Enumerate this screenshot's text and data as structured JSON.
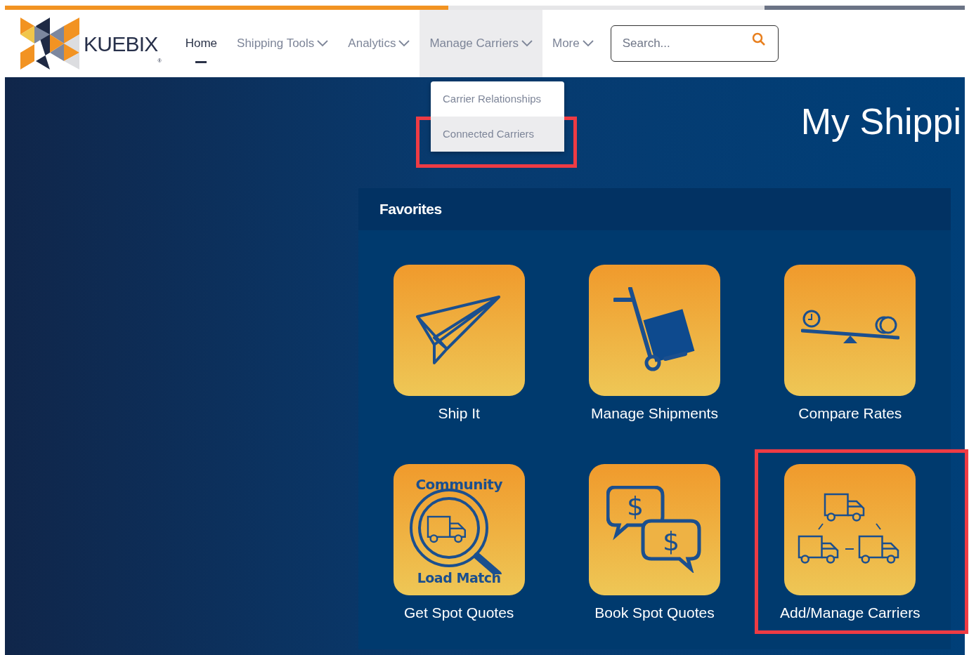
{
  "logo": {
    "text": "KUEBIX",
    "mark": "®"
  },
  "nav": [
    {
      "label": "Home",
      "selected": true,
      "dropdown": false,
      "expanded": false
    },
    {
      "label": "Shipping Tools",
      "selected": false,
      "dropdown": true,
      "expanded": false
    },
    {
      "label": "Analytics",
      "selected": false,
      "dropdown": true,
      "expanded": false
    },
    {
      "label": "Manage Carriers",
      "selected": false,
      "dropdown": true,
      "expanded": true
    },
    {
      "label": "More",
      "selected": false,
      "dropdown": true,
      "expanded": false
    }
  ],
  "search": {
    "placeholder": "Search..."
  },
  "dropdown_menu": [
    {
      "label": "Carrier Relationships",
      "highlighted": false
    },
    {
      "label": "Connected Carriers",
      "highlighted": true
    }
  ],
  "page_title": "My Shippi",
  "favorites": {
    "title": "Favorites",
    "tiles": [
      {
        "label": "Ship It",
        "kind": "plane",
        "highlighted": false
      },
      {
        "label": "Manage Shipments",
        "kind": "handtruck",
        "highlighted": false
      },
      {
        "label": "Compare Rates",
        "kind": "scale",
        "highlighted": false
      },
      {
        "label": "Get Spot Quotes",
        "kind": "loadmatch",
        "top_text": "Community",
        "bottom_text": "Load Match",
        "highlighted": false
      },
      {
        "label": "Book Spot Quotes",
        "kind": "quotes",
        "symbols": [
          "$",
          "$"
        ],
        "highlighted": false
      },
      {
        "label": "Add/Manage Carriers",
        "kind": "trucks",
        "highlighted": true
      }
    ]
  }
}
